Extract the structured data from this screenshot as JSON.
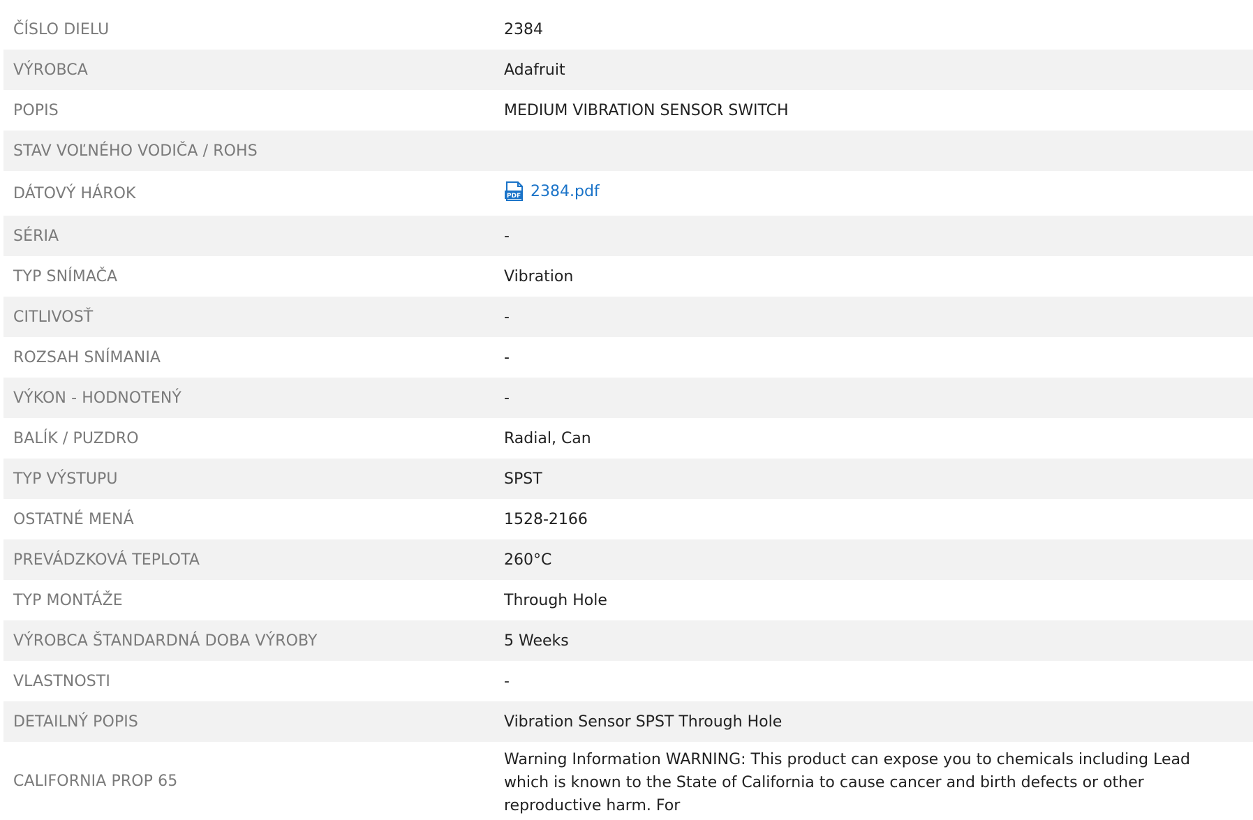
{
  "rows": [
    {
      "label": "ČÍSLO DIELU",
      "value": "2384"
    },
    {
      "label": "VÝROBCA",
      "value": "Adafruit"
    },
    {
      "label": "POPIS",
      "value": "MEDIUM VIBRATION SENSOR SWITCH"
    },
    {
      "label": "STAV VOĽNÉHO VODIČA / ROHS",
      "value": ""
    },
    {
      "label": "DÁTOVÝ HÁROK",
      "value": "2384.pdf",
      "icon": "pdf-icon"
    },
    {
      "label": "SÉRIA",
      "value": "-"
    },
    {
      "label": "TYP SNÍMAČA",
      "value": "Vibration"
    },
    {
      "label": "CITLIVOSŤ",
      "value": "-"
    },
    {
      "label": "ROZSAH SNÍMANIA",
      "value": "-"
    },
    {
      "label": "VÝKON - HODNOTENÝ",
      "value": "-"
    },
    {
      "label": "BALÍK / PUZDRO",
      "value": "Radial, Can"
    },
    {
      "label": "TYP VÝSTUPU",
      "value": "SPST"
    },
    {
      "label": "OSTATNÉ MENÁ",
      "value": "1528-2166"
    },
    {
      "label": "PREVÁDZKOVÁ TEPLOTA",
      "value": "260°C"
    },
    {
      "label": "TYP MONTÁŽE",
      "value": "Through Hole"
    },
    {
      "label": "VÝROBCA ŠTANDARDNÁ DOBA VÝROBY",
      "value": "5 Weeks"
    },
    {
      "label": "VLASTNOSTI",
      "value": "-"
    },
    {
      "label": "DETAILNÝ POPIS",
      "value": "Vibration Sensor SPST Through Hole"
    },
    {
      "label": "CALIFORNIA PROP 65",
      "value": "Warning Information WARNING: This product can expose you to chemicals including Lead which is known to the State of California to cause cancer and birth defects or other reproductive harm. For"
    }
  ],
  "colors": {
    "label": "#7a7a7a",
    "value": "#222222",
    "link": "#1a73c8",
    "alt_row": "#f2f2f2"
  }
}
